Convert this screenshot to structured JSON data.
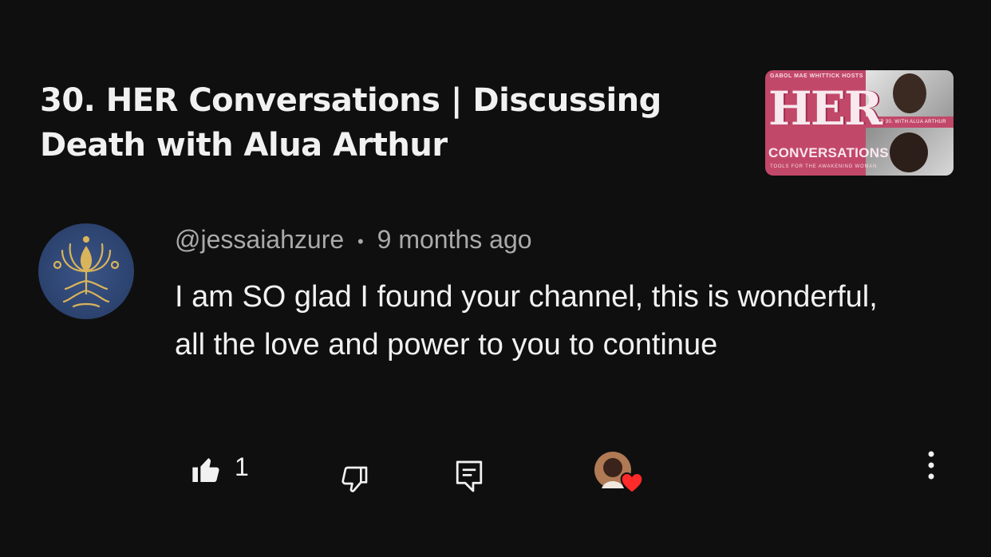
{
  "video": {
    "title": "30. HER Conversations | Discussing Death with Alua Arthur",
    "thumbnail": {
      "top_text": "GABOL MAE WHITTICK HOSTS",
      "her_text": "HER",
      "conversations_text": "CONVERSATIONS",
      "tagline": "TOOLS FOR THE AWAKENING WOMAN",
      "episode_text": "EP 30. WITH ALUA ARTHUR"
    }
  },
  "comment": {
    "author": "@jessaiahzure",
    "separator": "•",
    "time": "9 months ago",
    "text": "I am SO glad I found your channel, this is wonderful, all the love and power to you to continue",
    "like_count": "1"
  },
  "icons": {
    "like": "thumbs-up-icon",
    "dislike": "thumbs-down-icon",
    "reply": "reply-icon",
    "creator_heart": "creator-heart-icon",
    "more": "more-vert-icon"
  },
  "colors": {
    "background": "#0f0f0f",
    "primary_text": "#f1f1f1",
    "secondary_text": "#aaaaaa",
    "heart": "#ff2a2a",
    "thumbnail_pink": "#c2486a"
  }
}
